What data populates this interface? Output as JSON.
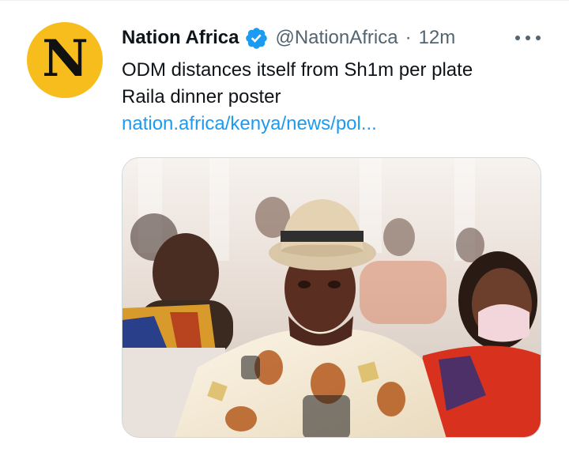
{
  "tweet": {
    "author_name": "Nation Africa",
    "handle": "@NationAfrica",
    "separator": "·",
    "time": "12m",
    "text_lines": [
      "ODM distances itself from Sh1m per plate",
      "Raila dinner poster"
    ],
    "link": "nation.africa/kenya/news/pol..."
  },
  "avatar": {
    "letter": "N",
    "color": "#f7bd1c"
  },
  "icons": {
    "verified": "verified-badge-icon",
    "more": "more-options-icon"
  },
  "colors": {
    "accent": "#1d9bf0",
    "muted": "#536471",
    "text": "#0f1419"
  }
}
